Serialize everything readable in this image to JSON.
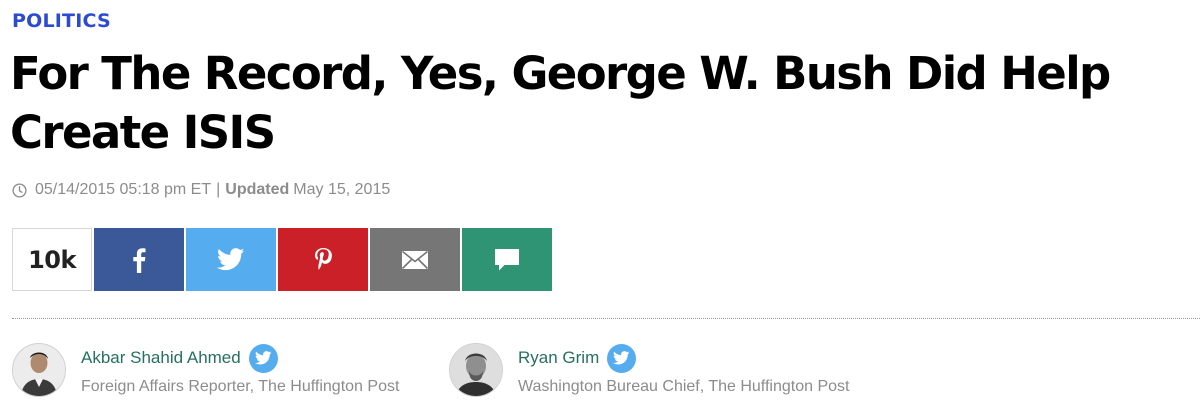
{
  "article": {
    "section": "POLITICS",
    "headline": "For The Record, Yes, George W. Bush Did Help Create ISIS",
    "published": "05/14/2015 05:18 pm ET",
    "separator": "|",
    "updated_label": "Updated",
    "updated_date": "May 15, 2015"
  },
  "share": {
    "count": "10k",
    "buttons": [
      {
        "network": "facebook",
        "icon": "facebook-icon",
        "color": "#3b5998"
      },
      {
        "network": "twitter",
        "icon": "twitter-icon",
        "color": "#55acee"
      },
      {
        "network": "pinterest",
        "icon": "pinterest-icon",
        "color": "#cb2027"
      },
      {
        "network": "email",
        "icon": "envelope-icon",
        "color": "#767676"
      },
      {
        "network": "comment",
        "icon": "comment-icon",
        "color": "#2f9474"
      }
    ]
  },
  "authors": [
    {
      "name": "Akbar Shahid Ahmed",
      "title": "Foreign Affairs Reporter, The Huffington Post",
      "icon": "twitter-icon"
    },
    {
      "name": "Ryan Grim",
      "title": "Washington Bureau Chief, The Huffington Post",
      "icon": "twitter-icon"
    }
  ],
  "colors": {
    "section": "#2d4bd2",
    "author_name": "#25715f",
    "meta_text": "#8c8c8c"
  }
}
